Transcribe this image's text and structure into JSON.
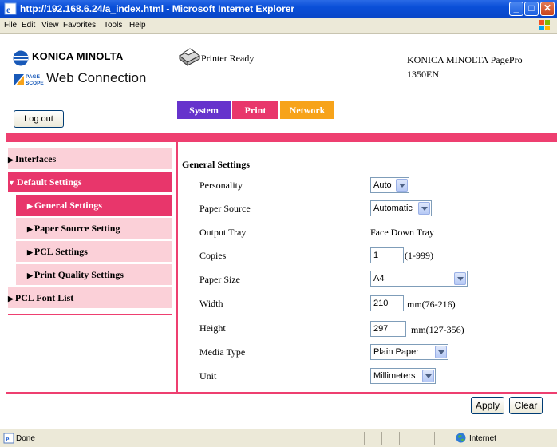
{
  "window": {
    "title": "http://192.168.6.24/a_index.html - Microsoft Internet Explorer",
    "menu": [
      "File",
      "Edit",
      "View",
      "Favorites",
      "Tools",
      "Help"
    ]
  },
  "header": {
    "brand": "KONICA MINOLTA",
    "product": "Web Connection",
    "status": "Printer Ready",
    "model_line1": "KONICA MINOLTA PagePro",
    "model_line2": "1350EN",
    "logout_label": "Log out"
  },
  "tabs": [
    {
      "label": "System",
      "color": "#6633cc"
    },
    {
      "label": "Print",
      "color": "#e8366b"
    },
    {
      "label": "Network",
      "color": "#f7a31a"
    }
  ],
  "sidebar": {
    "items": [
      {
        "label": "Interfaces"
      },
      {
        "label": "Default Settings",
        "active": true
      },
      {
        "label": "General Settings",
        "active": true
      },
      {
        "label": "Paper Source Setting"
      },
      {
        "label": "PCL Settings"
      },
      {
        "label": "Print Quality Settings"
      },
      {
        "label": "PCL Font List"
      }
    ]
  },
  "main": {
    "section_title": "General Settings",
    "rows": {
      "personality": {
        "label": "Personality",
        "value": "Auto"
      },
      "paper_source": {
        "label": "Paper Source",
        "value": "Automatic"
      },
      "output_tray": {
        "label": "Output Tray",
        "value": "Face Down Tray"
      },
      "copies": {
        "label": "Copies",
        "value": "1",
        "hint": "(1-999)"
      },
      "paper_size": {
        "label": "Paper Size",
        "value": "A4"
      },
      "width": {
        "label": "Width",
        "value": "210",
        "hint": "mm(76-216)"
      },
      "height": {
        "label": "Height",
        "value": "297",
        "hint": "mm(127-356)"
      },
      "media_type": {
        "label": "Media Type",
        "value": "Plain Paper"
      },
      "unit": {
        "label": "Unit",
        "value": "Millimeters"
      }
    },
    "apply_label": "Apply",
    "clear_label": "Clear"
  },
  "statusbar": {
    "left": "Done",
    "zone": "Internet"
  },
  "colors": {
    "accent_pink": "#ee3f70",
    "nav_bg": "#fbd0d8",
    "nav_active": "#e8366b"
  }
}
